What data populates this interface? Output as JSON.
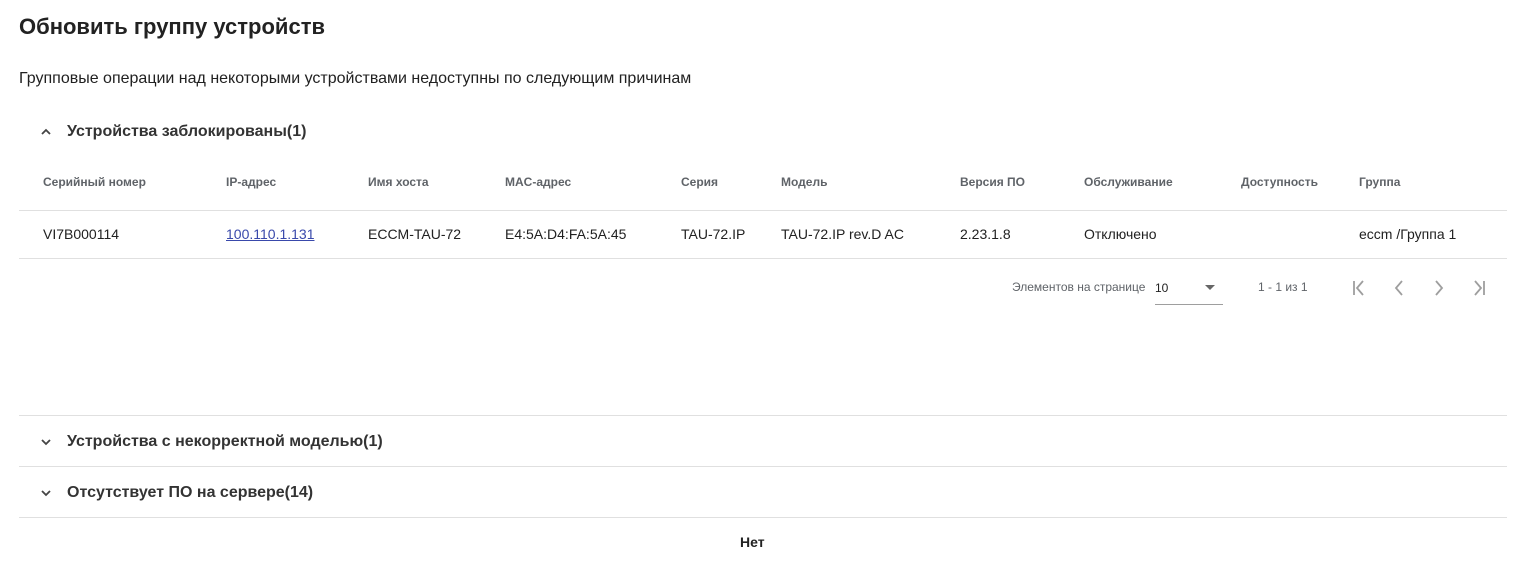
{
  "page": {
    "title": "Обновить группу устройств",
    "description": "Групповые операции над некоторыми устройствами недоступны по следующим причинам"
  },
  "panels": [
    {
      "title": "Устройства заблокированы(1)",
      "expanded": true
    },
    {
      "title": "Устройства с некорректной моделью(1)",
      "expanded": false
    },
    {
      "title": "Отсутствует ПО на сервере(14)",
      "expanded": false
    }
  ],
  "table": {
    "headers": [
      "Серийный номер",
      "IP-адрес",
      "Имя хоста",
      "MAC-адрес",
      "Серия",
      "Модель",
      "Версия ПО",
      "Обслуживание",
      "Доступность",
      "Группа"
    ],
    "rows": [
      {
        "serial": "VI7B000114",
        "ip": "100.110.1.131",
        "hostname": "ECCM-TAU-72",
        "mac": "E4:5A:D4:FA:5A:45",
        "series": "TAU-72.IP",
        "model": "TAU-72.IP rev.D AC",
        "firmware": "2.23.1.8",
        "maintenance": "Отключено",
        "availability": "",
        "group": "eccm /Группа 1"
      }
    ]
  },
  "paginator": {
    "items_per_page_label": "Элементов на странице",
    "page_size": "10",
    "range_label": "1 - 1 из 1"
  },
  "footer": {
    "button_label": "Нет"
  },
  "colors": {
    "link": "#3949ab",
    "divider": "#e0e0e0",
    "header_text": "#5f6368"
  },
  "icons": [
    "chevron-up-icon",
    "chevron-down-icon",
    "first-page-icon",
    "prev-page-icon",
    "next-page-icon",
    "last-page-icon",
    "dropdown-arrow-icon"
  ]
}
